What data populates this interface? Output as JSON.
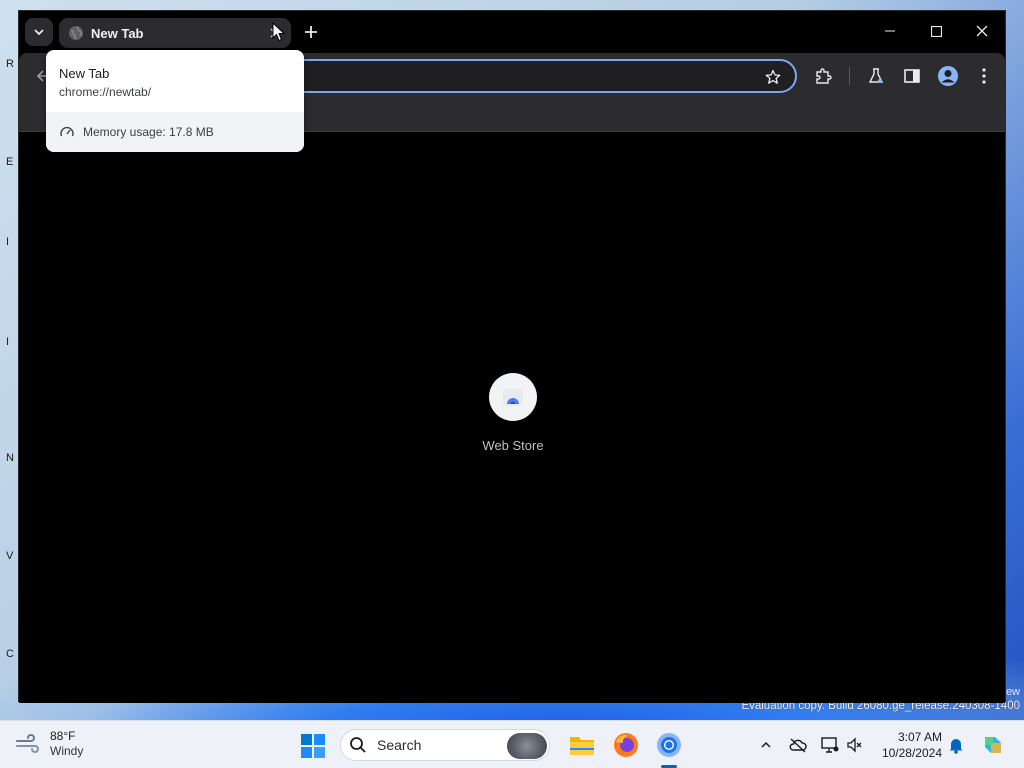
{
  "desktop": {
    "edge_letters": [
      "R",
      "E",
      "I",
      "I",
      "N",
      "V",
      "C"
    ],
    "watermark_partial": "ew",
    "watermark": "Evaluation copy. Build 26080.ge_release.240308-1400"
  },
  "browser": {
    "tab": {
      "title": "New Tab",
      "favicon": "globe-icon"
    },
    "omnibox": {
      "value": ""
    },
    "shortcut": {
      "label": "Web Store",
      "icon": "web-store-icon"
    }
  },
  "hovercard": {
    "title": "New Tab",
    "url": "chrome://newtab/",
    "memory": "Memory usage: 17.8 MB"
  },
  "taskbar": {
    "weather": {
      "temp": "88°F",
      "condition": "Windy"
    },
    "search_label": "Search",
    "apps": [
      "file-explorer-icon",
      "firefox-icon",
      "chrome-icon"
    ],
    "clock": {
      "time": "3:07 AM",
      "date": "10/28/2024"
    }
  },
  "colors": {
    "accent": "#7aa7f3",
    "toolbar_bg": "#2c2c2e",
    "content_bg": "#000000",
    "taskbar_bg": "#eef2f8"
  }
}
